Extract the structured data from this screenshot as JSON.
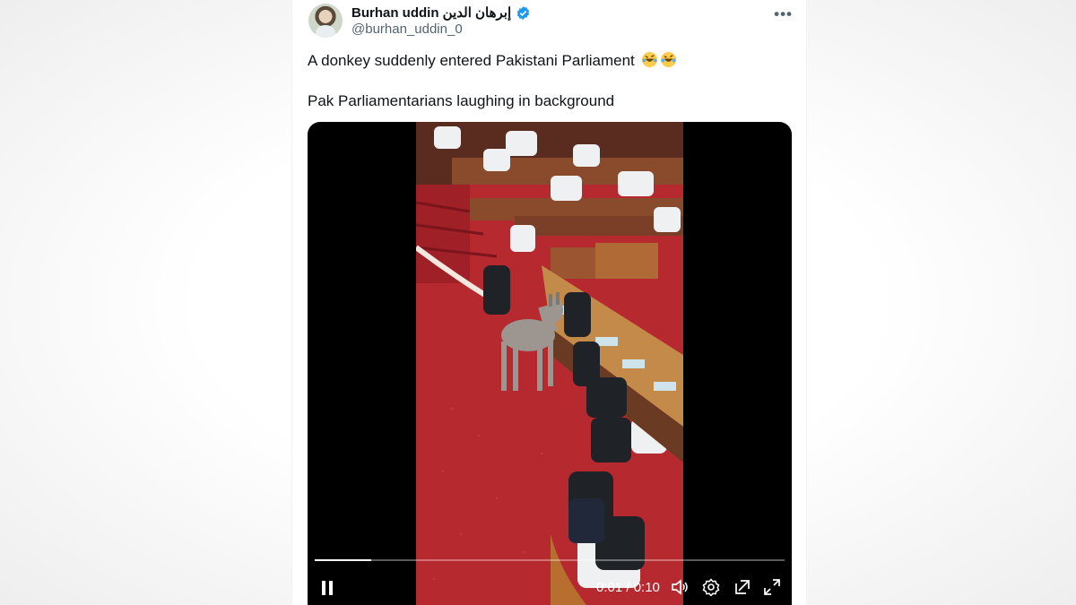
{
  "tweet": {
    "display_name": "Burhan uddin إبرهان الدين",
    "handle": "@burhan_uddin_0",
    "more_label": "•••",
    "text_line_1": "A donkey suddenly entered Pakistani Parliament",
    "text_line_2": "Pak Parliamentarians laughing in background",
    "emojis": [
      "rolling-on-floor-laughing",
      "rolling-on-floor-laughing"
    ]
  },
  "video": {
    "elapsed": "0:01",
    "duration": "0:10",
    "time_label": "0:01 / 0:10",
    "progress_fraction": 0.12,
    "controls": [
      "pause-icon",
      "volume-icon",
      "settings-icon",
      "pop-out-icon",
      "fullscreen-icon"
    ]
  },
  "colors": {
    "verified": "#1d9bf0",
    "text": "#0f1419",
    "secondary": "#536471",
    "video_bg": "#000000",
    "carpet": "#b3262d"
  }
}
